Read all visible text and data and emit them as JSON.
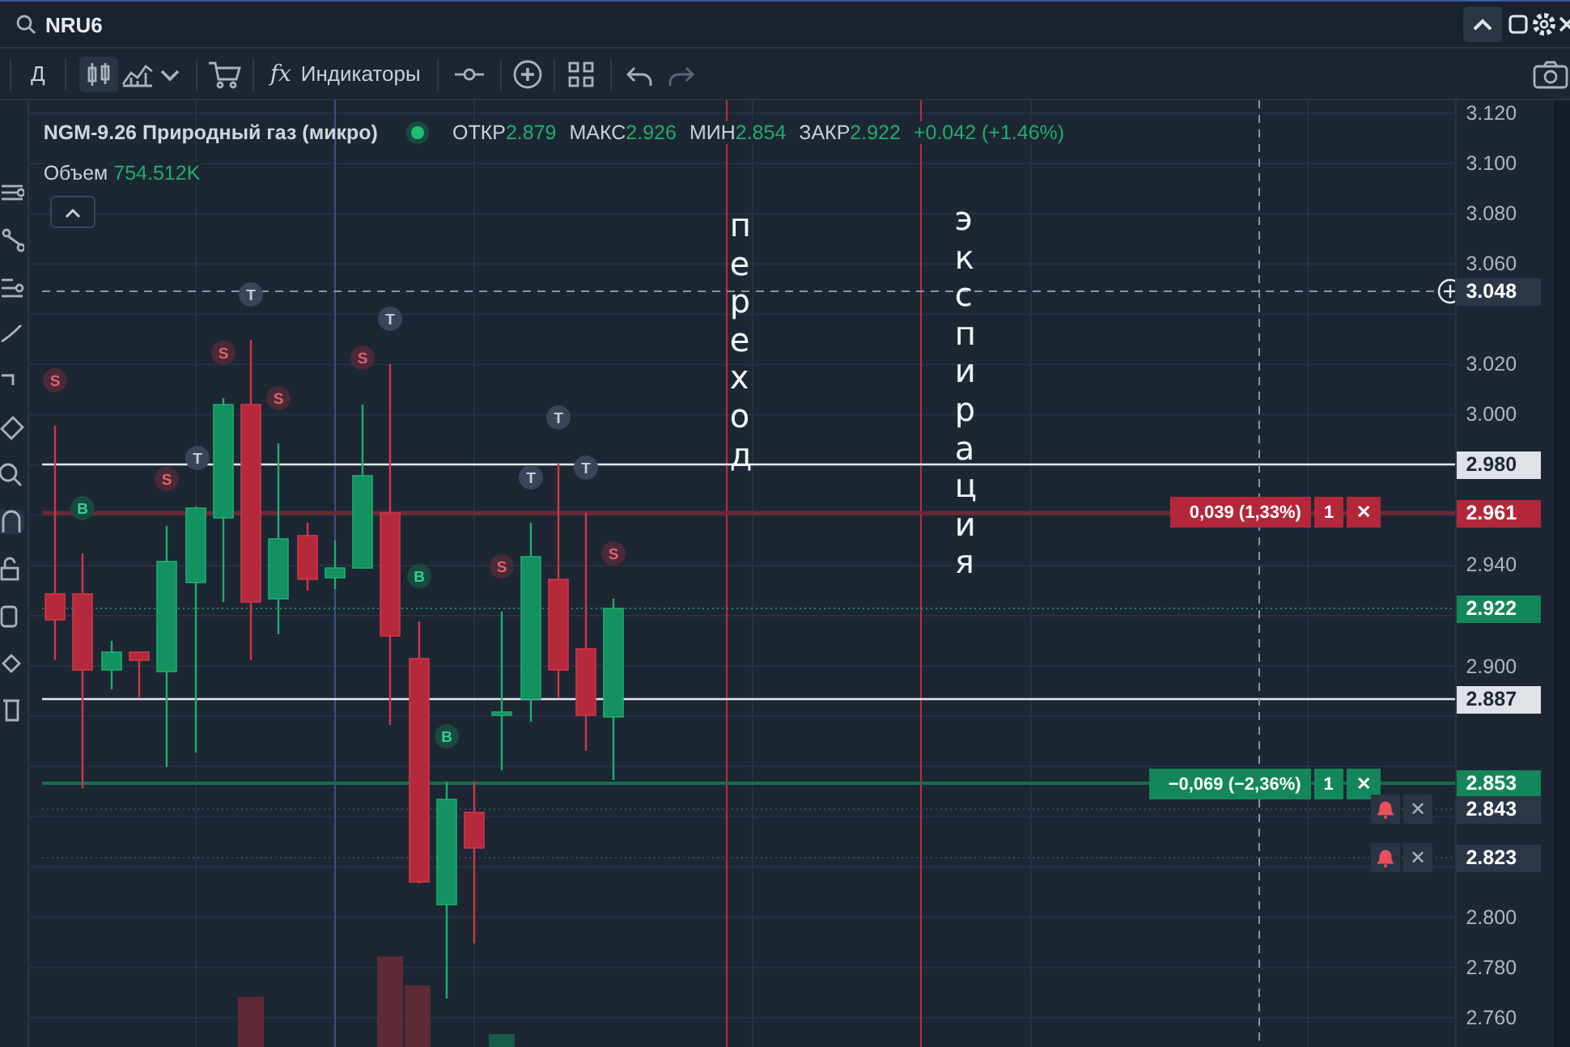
{
  "search": {
    "value": "NRU6"
  },
  "toolbar": {
    "interval": "Д",
    "indicators_icon": "fx",
    "indicators_label": "Индикаторы"
  },
  "legend": {
    "symbol": "NGM-9.26 Природный газ (микро)",
    "stats": [
      {
        "label": "ОТКР",
        "value": "2.879"
      },
      {
        "label": "МАКС",
        "value": "2.926"
      },
      {
        "label": "МИН",
        "value": "2.854"
      },
      {
        "label": "ЗАКР",
        "value": "2.922"
      }
    ],
    "change": "+0.042 (+1.46%)",
    "volume_label": "Объем",
    "volume_value": "754.512K"
  },
  "annotations": [
    {
      "text": "переход"
    },
    {
      "text": "экспирация"
    }
  ],
  "markers": [
    {
      "kind": "trade",
      "letter": "T"
    },
    {
      "kind": "trade",
      "letter": "T"
    },
    {
      "kind": "sell",
      "letter": "S"
    },
    {
      "kind": "sell",
      "letter": "S"
    },
    {
      "kind": "sell",
      "letter": "S"
    },
    {
      "kind": "sell",
      "letter": "S"
    },
    {
      "kind": "trade",
      "letter": "T"
    },
    {
      "kind": "sell",
      "letter": "S"
    },
    {
      "kind": "buy",
      "letter": "B"
    },
    {
      "kind": "buy",
      "letter": "B"
    },
    {
      "kind": "sell",
      "letter": "S"
    },
    {
      "kind": "sell",
      "letter": "S"
    },
    {
      "kind": "trade",
      "letter": "T"
    },
    {
      "kind": "trade",
      "letter": "T"
    },
    {
      "kind": "trade",
      "letter": "T"
    },
    {
      "kind": "buy",
      "letter": "B"
    }
  ],
  "orders": [
    {
      "kind": "short",
      "pnl": "0,039 (1,33%)",
      "qty": "1",
      "close": "✕"
    },
    {
      "kind": "long",
      "pnl": "−0,069 (−2,36%)",
      "qty": "1",
      "close": "✕"
    }
  ],
  "alerts": [
    {
      "close": "✕"
    },
    {
      "close": "✕"
    }
  ],
  "price_axis": {
    "labels": [
      "3.120",
      "3.100",
      "3.080",
      "3.060",
      "3.020",
      "3.000",
      "2.940",
      "2.900",
      "2.800",
      "2.780",
      "2.760"
    ]
  },
  "price_tags": [
    {
      "kind": "crosshair",
      "text": "3.048"
    },
    {
      "kind": "line",
      "text": "2.980"
    },
    {
      "kind": "short",
      "text": "2.961"
    },
    {
      "kind": "last",
      "text": "2.922"
    },
    {
      "kind": "line",
      "text": "2.887"
    },
    {
      "kind": "long",
      "text": "2.853"
    },
    {
      "kind": "alert",
      "text": "2.843"
    },
    {
      "kind": "alert",
      "text": "2.823"
    }
  ]
}
